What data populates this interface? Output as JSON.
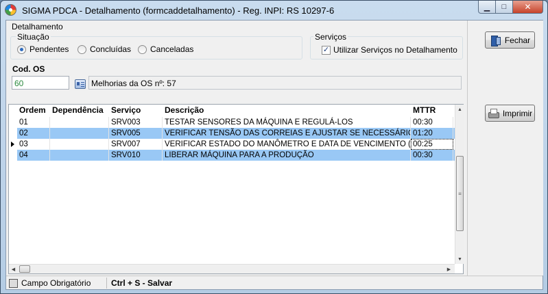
{
  "window": {
    "title": "SIGMA PDCA - Detalhamento  (formcaddetalhamento)  - Reg. INPI: RS 10297-6",
    "minimize_glyph": "▁",
    "maximize_glyph": "□",
    "close_glyph": "✕"
  },
  "detalhamento": {
    "label": "Detalhamento",
    "situacao": {
      "label": "Situação",
      "options": [
        {
          "label": "Pendentes",
          "checked": true
        },
        {
          "label": "Concluídas",
          "checked": false
        },
        {
          "label": "Canceladas",
          "checked": false
        }
      ]
    }
  },
  "servicos": {
    "label": "Serviços",
    "checkbox_label": "Utilizar Serviços no Detalhamento",
    "checked": true,
    "check_glyph": "✓"
  },
  "cod_os": {
    "label": "Cod. OS",
    "value": "60",
    "description": "Melhorias da OS nº: 57"
  },
  "buttons": {
    "fechar": "Fechar",
    "imprimir": "Imprimir"
  },
  "grid": {
    "columns": [
      "Ordem",
      "Dependência",
      "Serviço",
      "Descrição",
      "MTTR"
    ],
    "rows": [
      {
        "ordem": "01",
        "dependencia": "",
        "servico": "SRV003",
        "descricao": "TESTAR SENSORES DA MÁQUINA E REGULÁ-LOS",
        "mttr": "00:30",
        "selected": false
      },
      {
        "ordem": "02",
        "dependencia": "",
        "servico": "SRV005",
        "descricao": "VERIFICAR TENSÃO DAS CORREIAS E AJUSTAR SE NECESSÁRIO",
        "mttr": "01:20",
        "selected": true
      },
      {
        "ordem": "03",
        "dependencia": "",
        "servico": "SRV007",
        "descricao": "VERIFICAR ESTADO DO MANÔMETRO E DATA DE VENCIMENTO (TRO",
        "mttr": "00:25",
        "selected": false,
        "current": true
      },
      {
        "ordem": "04",
        "dependencia": "",
        "servico": "SRV010",
        "descricao": "LIBERAR MÁQUINA PARA A PRODUÇÃO",
        "mttr": "00:30",
        "selected": true
      }
    ]
  },
  "statusbar": {
    "campo_obrigatorio": "Campo Obrigatório",
    "shortcut": "Ctrl + S - Salvar"
  },
  "colors": {
    "selected_row": "#99c8f5",
    "code_text": "#2b8a3e"
  },
  "icons": [
    "app-icon",
    "lookup-icon",
    "door-exit-icon",
    "printer-icon",
    "row-indicator-icon"
  ]
}
